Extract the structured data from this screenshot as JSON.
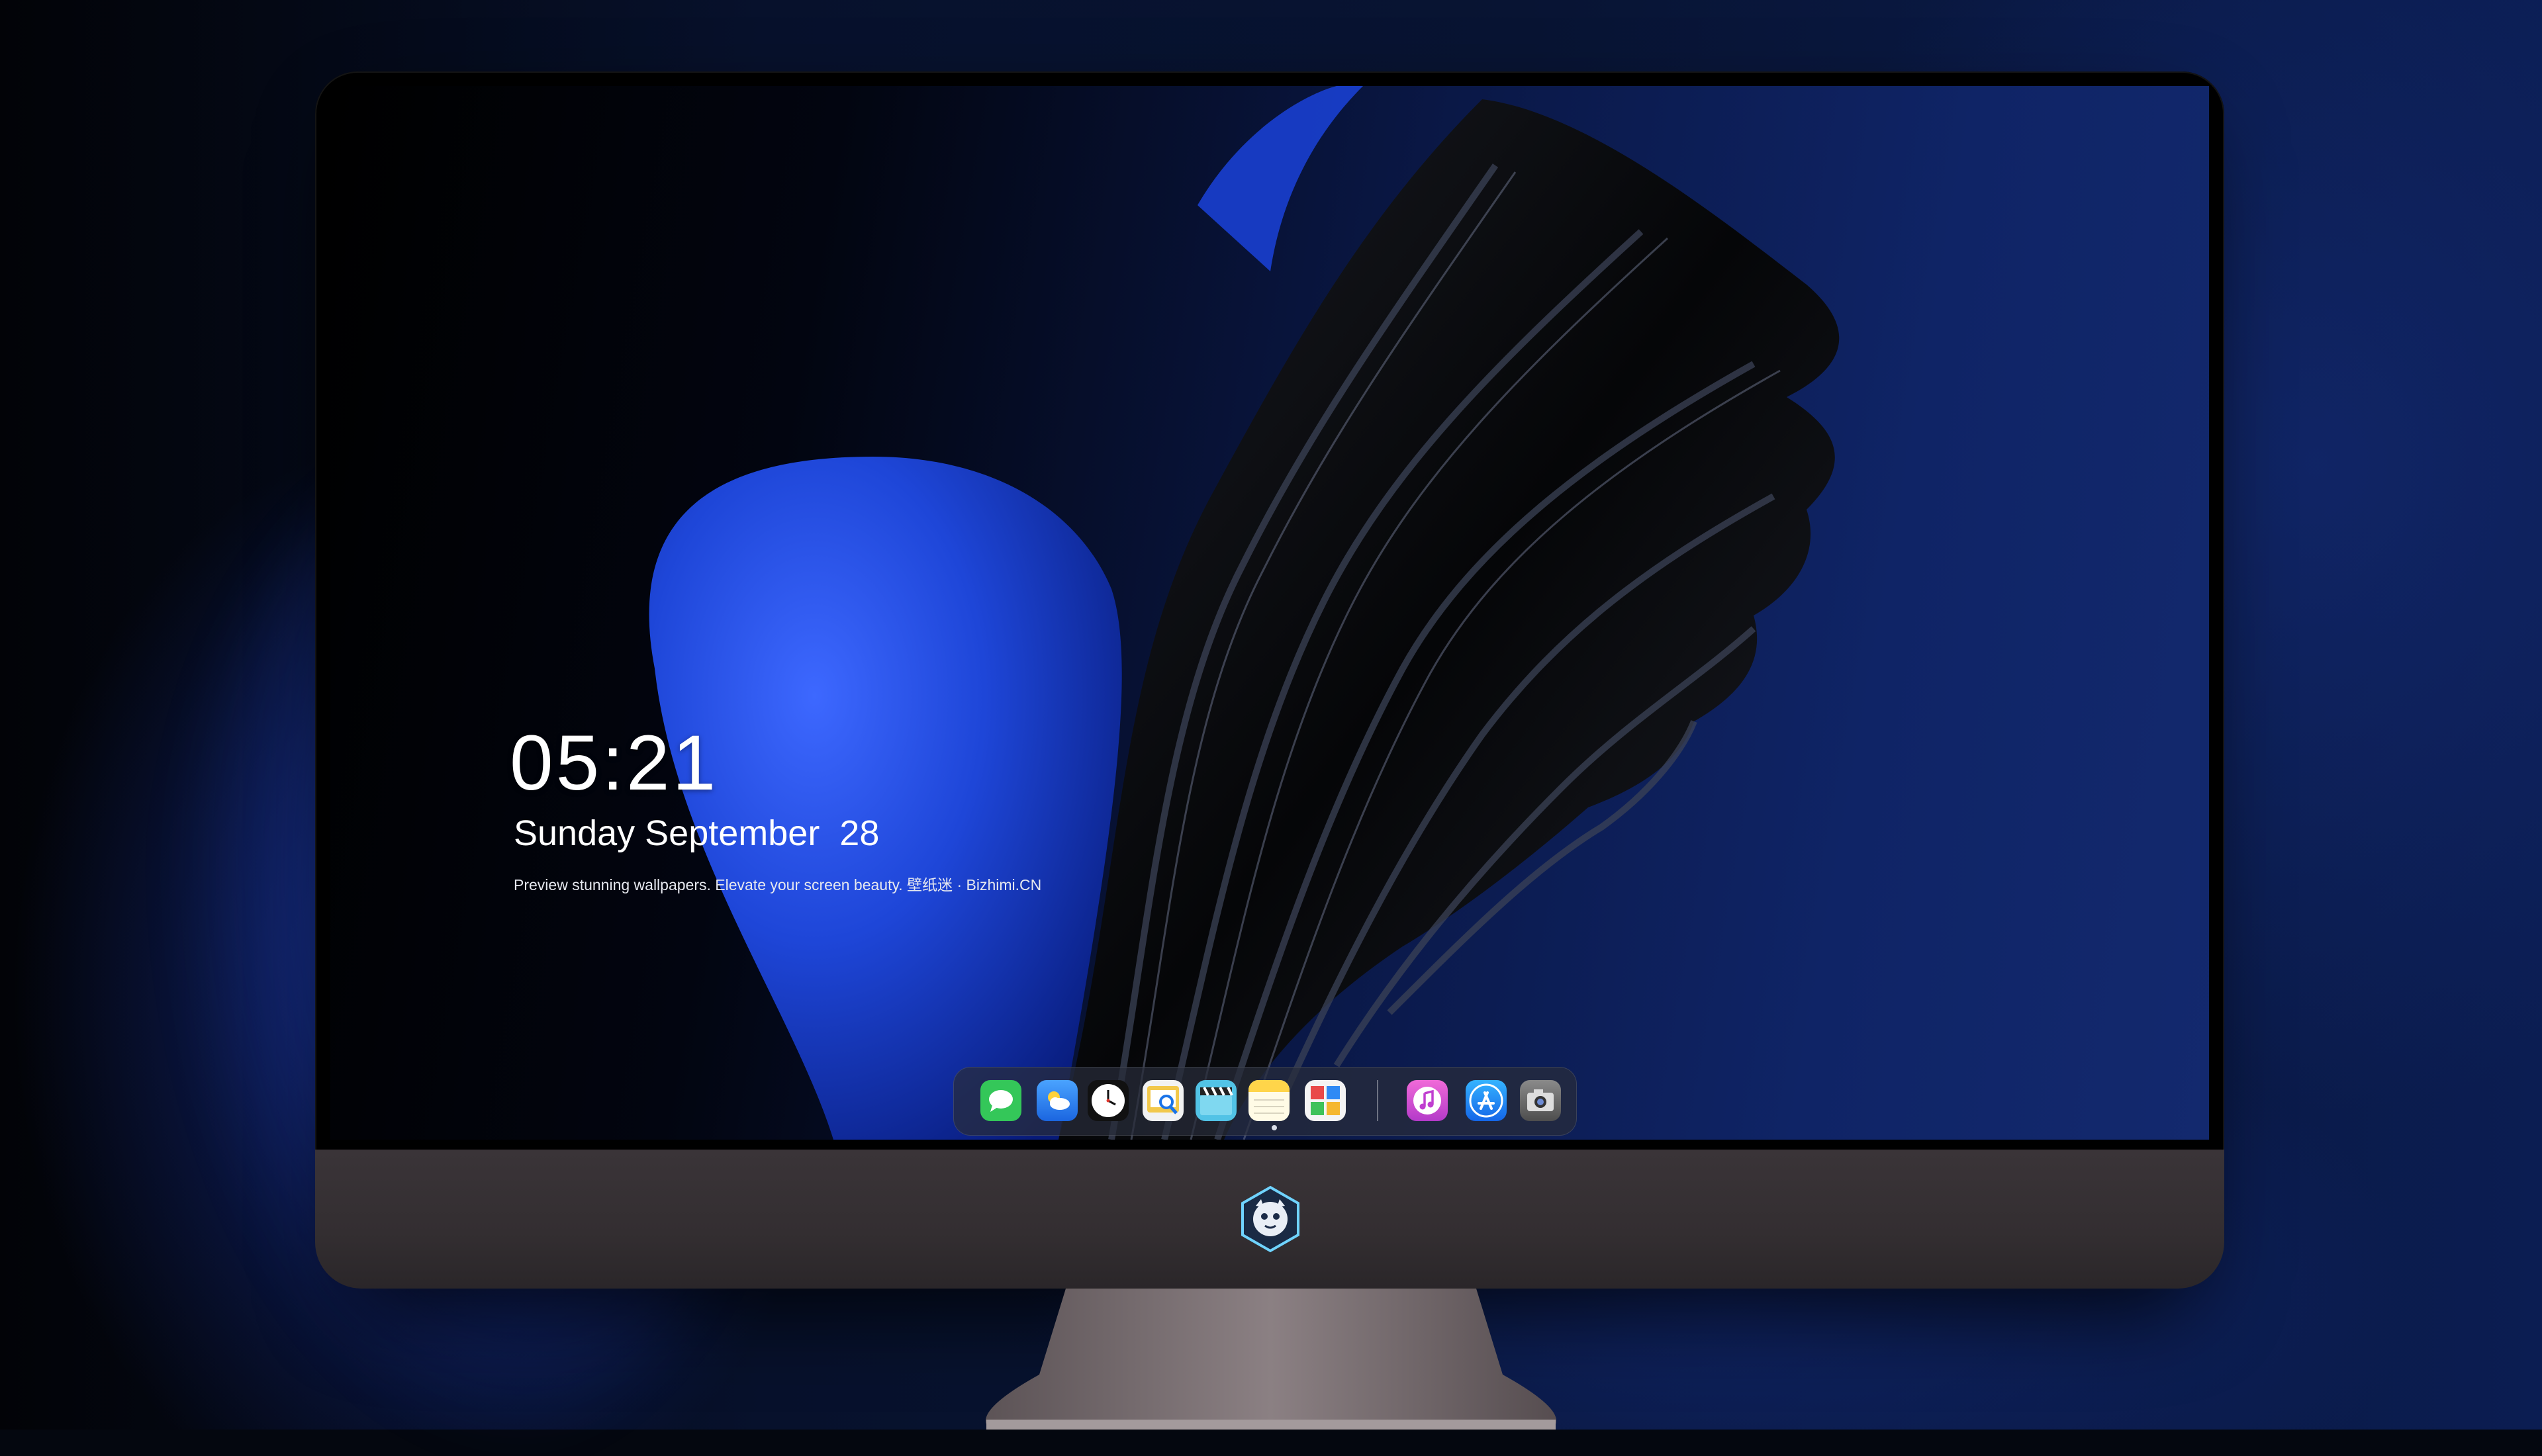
{
  "lock_screen": {
    "time": "05:21",
    "date": "Sunday September  28",
    "tagline": "Preview stunning wallpapers. Elevate your screen beauty. 壁纸迷 · Bizhimi.CN"
  },
  "dock": {
    "apps": [
      {
        "name": "Messages",
        "icon": "messages-icon",
        "color": "#34c759"
      },
      {
        "name": "Weather",
        "icon": "weather-icon",
        "color": "#2f7ff0"
      },
      {
        "name": "Clock",
        "icon": "clock-icon",
        "color": "#111111"
      },
      {
        "name": "Preview",
        "icon": "preview-icon",
        "color": "#f2c84b"
      },
      {
        "name": "Video Editor",
        "icon": "clapperboard-icon",
        "color": "#52c3e6"
      },
      {
        "name": "Notes",
        "icon": "notes-icon",
        "color": "#ffd54a"
      },
      {
        "name": "Photo Booth",
        "icon": "photo-booth-icon",
        "color": "#e94a4a"
      },
      {
        "name": "iTunes",
        "icon": "music-icon",
        "color": "#d94fd6"
      },
      {
        "name": "App Store",
        "icon": "app-store-icon",
        "color": "#1f8bf3"
      },
      {
        "name": "Camera",
        "icon": "camera-icon",
        "color": "#6b6b6b"
      }
    ]
  },
  "chin": {
    "logo_icon": "mascot-logo-icon"
  },
  "colors": {
    "accent_blue": "#2a55e6",
    "chin": "#3a3438",
    "stand": "#7d7274"
  }
}
